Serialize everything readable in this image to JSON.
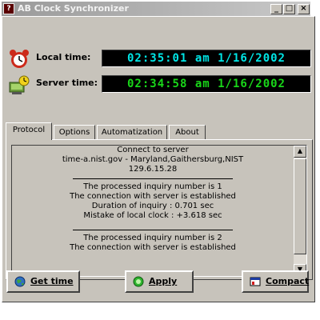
{
  "window": {
    "title": "AB Clock Synchronizer",
    "app_icon_glyph": "?",
    "controls": {
      "minimize": "_",
      "maximize": "□",
      "close": "×"
    }
  },
  "clocks": {
    "local": {
      "label": "Local time:",
      "value": "02:35:01 am  1/16/2002",
      "color": "#00e6e6",
      "icon": "alarm-clock-icon"
    },
    "server": {
      "label": "Server time:",
      "value": "02:34:58 am  1/16/2002",
      "color": "#19d719",
      "icon": "server-computer-icon"
    }
  },
  "tabs": [
    {
      "label": "Protocol",
      "active": true
    },
    {
      "label": "Options",
      "active": false
    },
    {
      "label": "Automatization",
      "active": false
    },
    {
      "label": "About",
      "active": false
    }
  ],
  "log": {
    "header": [
      "Connect to server",
      "time-a.nist.gov - Maryland,Gaithersburg,NIST",
      "129.6.15.28"
    ],
    "block1": [
      "The processed inquiry number is  1",
      "The connection with server is established",
      "Duration of inquiry : 0.701 sec",
      "Mistake of local clock : +3.618 sec"
    ],
    "block2": [
      "The processed inquiry number is  2",
      "The connection with server is established"
    ]
  },
  "scrollbar": {
    "up": "▲",
    "down": "▼"
  },
  "buttons": {
    "get_time": "Get time",
    "apply": "Apply",
    "compact": "Compact"
  }
}
